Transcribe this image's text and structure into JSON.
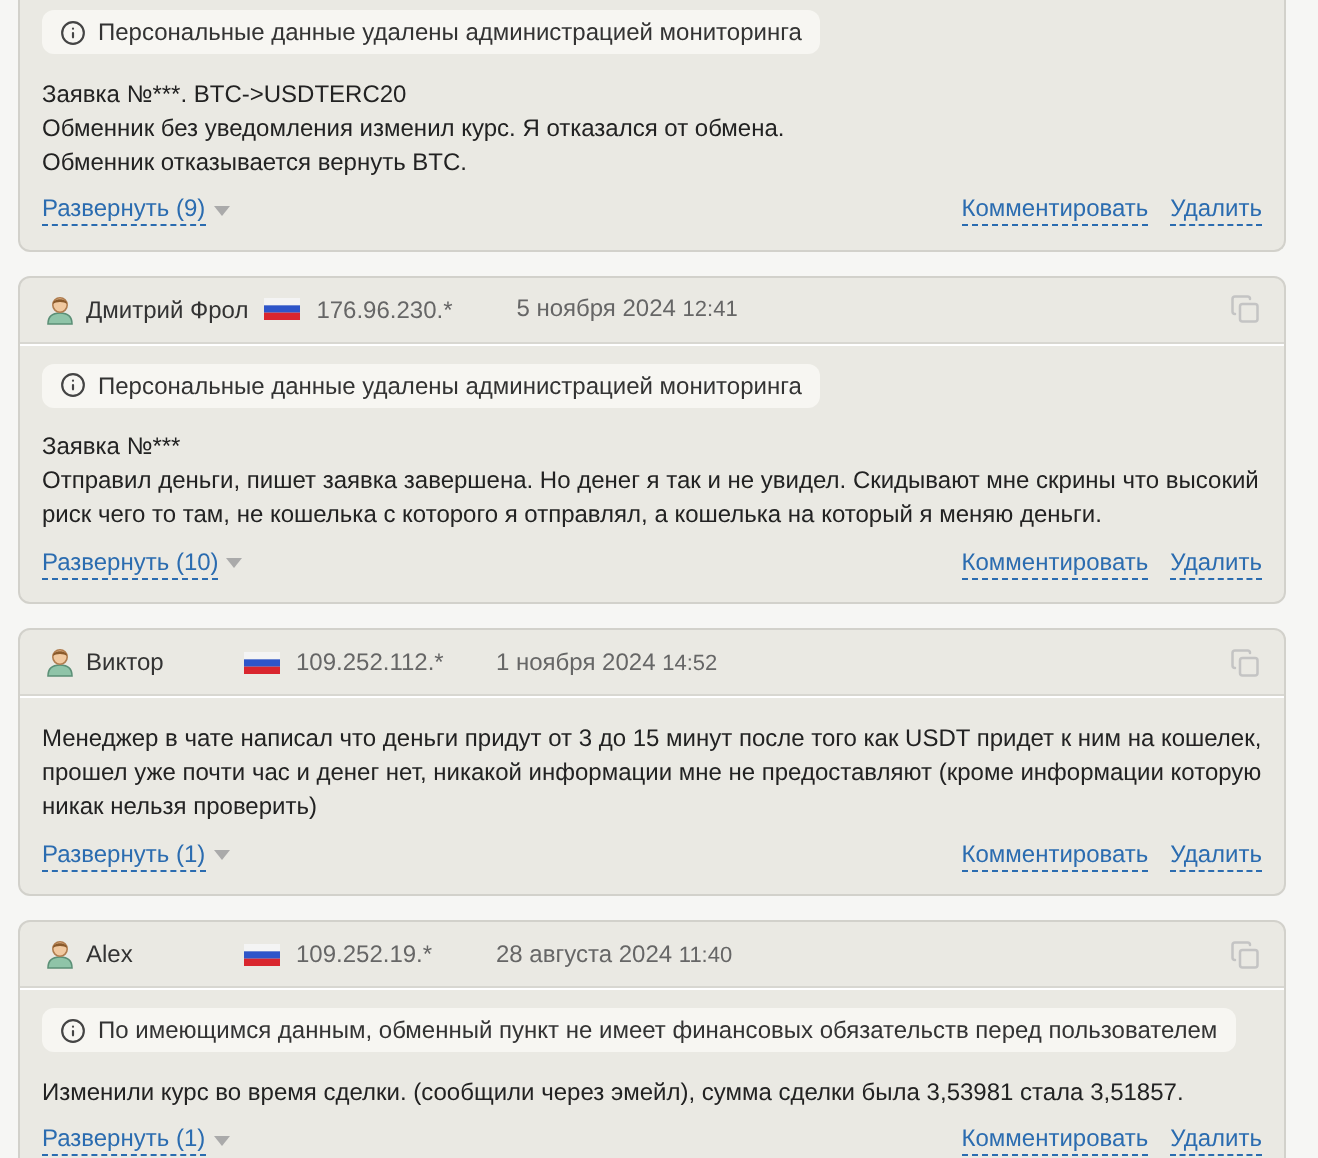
{
  "reviews": [
    {
      "notice": "Персональные данные удалены администрацией мониторинга",
      "paragraphs": [
        "Заявка №***. BTC->USDTERC20",
        "Обменник без уведомления изменил курс. Я отказался от обмена.",
        "Обменник отказывается вернуть BTC."
      ],
      "expand": "Развернуть (9)",
      "comment": "Комментировать",
      "delete": "Удалить"
    },
    {
      "author": "Дмитрий Фрол",
      "ip": "176.96.230.*",
      "date": "5 ноября 2024",
      "time": "12:41",
      "notice": "Персональные данные удалены администрацией мониторинга",
      "paragraphs": [
        "Заявка №***",
        "Отправил деньги, пишет заявка завершена. Но денег я так и не увидел. Скидывают мне скрины что высокий риск чего то там, не кошелька с которого я отправлял, а кошелька на который я меняю деньги."
      ],
      "expand": "Развернуть (10)",
      "comment": "Комментировать",
      "delete": "Удалить"
    },
    {
      "author": "Виктор",
      "ip": "109.252.112.*",
      "date": "1 ноября 2024",
      "time": "14:52",
      "paragraphs": [
        "Менеджер в чате написал что деньги придут от 3 до 15 минут после того как USDT придет к ним на кошелек, прошел уже почти час и денег нет, никакой информации мне не предоставляют (кроме информации которую никак нельзя проверить)"
      ],
      "expand": "Развернуть (1)",
      "comment": "Комментировать",
      "delete": "Удалить"
    },
    {
      "author": "Alex",
      "ip": "109.252.19.*",
      "date": "28 августа 2024",
      "time": "11:40",
      "notice": "По имеющимся данным, обменный пункт не имеет финансовых обязательств перед пользователем",
      "paragraphs": [
        "Изменили курс во время сделки. (сообщили через эмейл), сумма сделки была 3,53981 стала 3,51857."
      ],
      "expand": "Развернуть (1)",
      "comment": "Комментировать",
      "delete": "Удалить"
    }
  ]
}
